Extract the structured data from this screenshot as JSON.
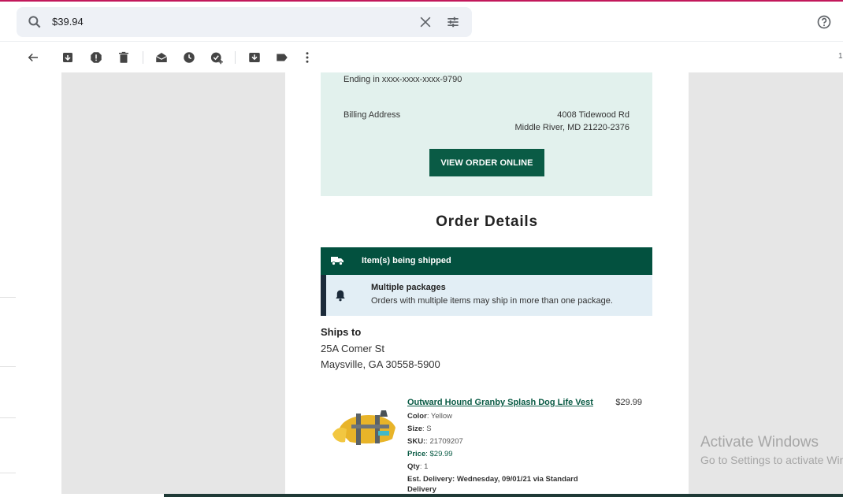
{
  "search": {
    "query": "$39.94"
  },
  "toolbar": {
    "pager_text": "1"
  },
  "billing": {
    "ending": "Ending in xxxx-xxxx-xxxx-9790",
    "label": "Billing Address",
    "address_line1": "4008 Tidewood Rd",
    "address_line2": "Middle River, MD 21220-2376",
    "button": "VIEW ORDER ONLINE"
  },
  "order": {
    "title": "Order Details",
    "shipping_status": "Item(s) being shipped",
    "notice_title": "Multiple packages",
    "notice_body": "Orders with multiple items may ship in more than one package."
  },
  "ships_to": {
    "label": "Ships to",
    "line1": "25A Comer St",
    "line2": "Maysville, GA 30558-5900"
  },
  "product": {
    "name": "Outward Hound Granby Splash Dog Life Vest",
    "price": "$29.99",
    "color_label": "Color",
    "color": ": Yellow",
    "size_label": "Size",
    "size": ": S",
    "sku_label": "SKU:",
    "sku": ": 21709207",
    "price_label": "Price",
    "price_value": ": $29.99",
    "qty_label": "Qty",
    "qty": ": 1",
    "delivery": "Est. Delivery: Wednesday, 09/01/21 via Standard Delivery"
  },
  "watermark": {
    "title": "Activate Windows",
    "subtitle": "Go to Settings to activate Windows."
  },
  "colors": {
    "accent_green": "#0a5b45",
    "ship_bar": "#03513f",
    "billing_bg": "#e2f1ed",
    "notice_bg": "#e2eef5"
  }
}
